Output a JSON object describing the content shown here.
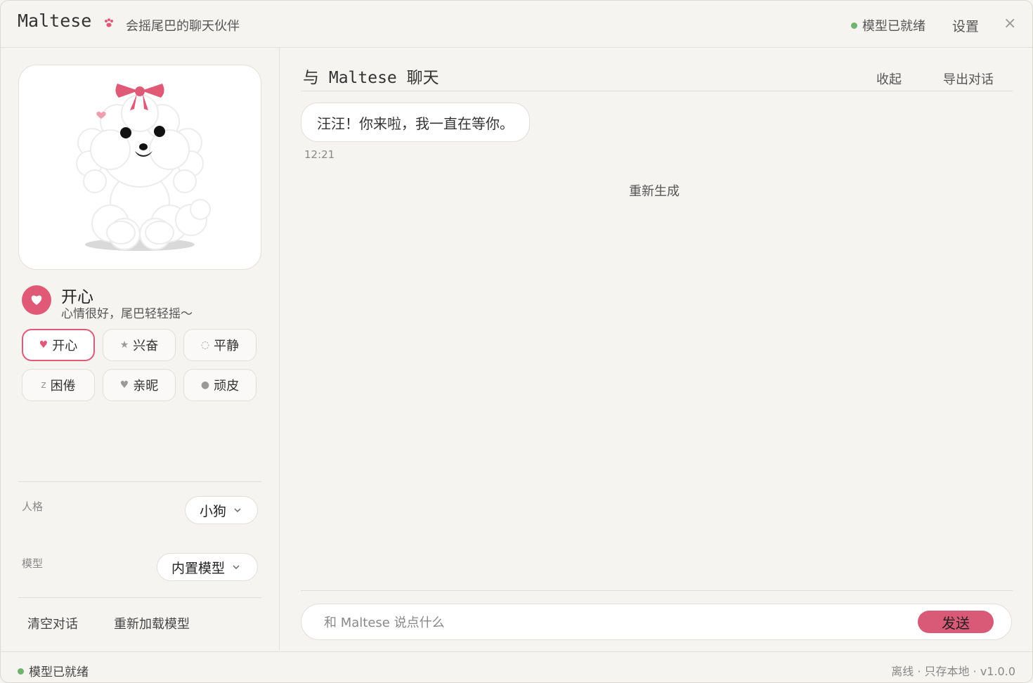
{
  "app": {
    "title": "Maltese",
    "subtitle": "会摇尾巴的聊天伙伴",
    "model_status": "模型已就绪",
    "settings_label": "设置",
    "close_glyph": "×"
  },
  "colors": {
    "accent": "#e05a78",
    "status_ok": "#6fb36f",
    "background": "#f6f4f1"
  },
  "mood": {
    "current_title": "开心",
    "current_desc": "心情很好，尾巴轻轻摇～",
    "buttons": [
      {
        "label": "开心",
        "icon": "heart-icon",
        "glyph": "♥",
        "active": true
      },
      {
        "label": "兴奋",
        "icon": "star-icon",
        "glyph": "★",
        "active": false
      },
      {
        "label": "平静",
        "icon": "cloud-icon",
        "glyph": "◌",
        "active": false
      },
      {
        "label": "困倦",
        "icon": "sleep-z-icon",
        "glyph": "z",
        "active": false
      },
      {
        "label": "亲昵",
        "icon": "heart-icon",
        "glyph": "♥",
        "active": false
      },
      {
        "label": "顽皮",
        "icon": "dot-icon",
        "glyph": "●",
        "active": false
      }
    ]
  },
  "settings": {
    "personality_label": "人格",
    "personality_value": "小狗",
    "model_label": "模型",
    "model_value": "内置模型"
  },
  "sidebar_actions": {
    "clear": "清空对话",
    "reload": "重新加载模型"
  },
  "chat": {
    "title": "与 Maltese 聊天",
    "collapse_label": "收起",
    "export_label": "导出对话",
    "messages": [
      {
        "text": "汪汪！你来啦，我一直在等你。",
        "time": "12:21"
      }
    ],
    "regenerate_label": "重新生成",
    "input_placeholder": "和 Maltese 说点什么",
    "send_label": "发送"
  },
  "footer": {
    "status": "模型已就绪",
    "info": "离线 · 只存本地 · v1.0.0"
  }
}
